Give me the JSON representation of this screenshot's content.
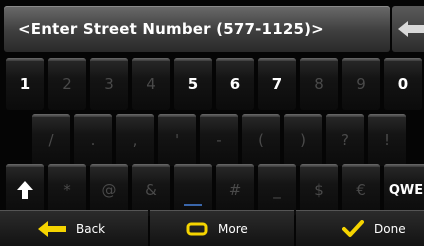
{
  "input": {
    "placeholder_text": "<Enter Street Number (577-1125)>"
  },
  "keyboard": {
    "row1": [
      {
        "label": "1",
        "enabled": true
      },
      {
        "label": "2",
        "enabled": false
      },
      {
        "label": "3",
        "enabled": false
      },
      {
        "label": "4",
        "enabled": false
      },
      {
        "label": "5",
        "enabled": true
      },
      {
        "label": "6",
        "enabled": true
      },
      {
        "label": "7",
        "enabled": true
      },
      {
        "label": "8",
        "enabled": false
      },
      {
        "label": "9",
        "enabled": false
      },
      {
        "label": "0",
        "enabled": true
      }
    ],
    "row2": [
      {
        "label": "/",
        "enabled": false
      },
      {
        "label": ".",
        "enabled": false
      },
      {
        "label": ",",
        "enabled": false
      },
      {
        "label": "'",
        "enabled": false
      },
      {
        "label": "-",
        "enabled": false
      },
      {
        "label": "(",
        "enabled": false
      },
      {
        "label": ")",
        "enabled": false
      },
      {
        "label": "?",
        "enabled": false
      },
      {
        "label": "!",
        "enabled": false
      }
    ],
    "row3": [
      {
        "label": "*",
        "enabled": false
      },
      {
        "label": "@",
        "enabled": false
      },
      {
        "label": "&",
        "enabled": false
      },
      {
        "label": "",
        "enabled": false
      },
      {
        "label": "#",
        "enabled": false
      },
      {
        "label": "_",
        "enabled": false
      },
      {
        "label": "$",
        "enabled": false
      },
      {
        "label": "€",
        "enabled": false
      }
    ],
    "layout_switch_label": "QWE",
    "shift_icon": "shift-arrow-up-icon"
  },
  "bottom_bar": {
    "back_label": "Back",
    "more_label": "More",
    "done_label": "Done"
  },
  "colors": {
    "accent_yellow": "#f5d400",
    "text": "#ffffff",
    "disabled_text": "#4a4a4a"
  }
}
